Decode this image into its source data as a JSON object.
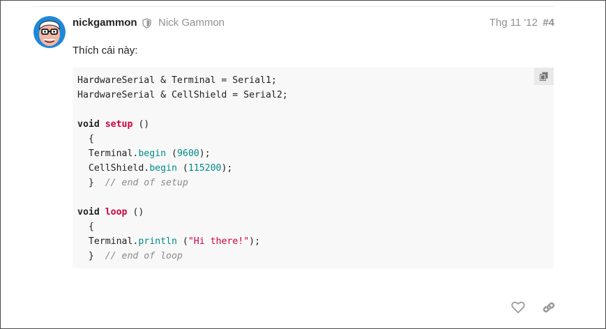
{
  "post": {
    "username": "nickgammon",
    "full_name": "Nick Gammon",
    "date": "Thg 11 '12",
    "post_number": "#4",
    "body_text": "Thích cái này:",
    "avatar_icon": "cartoon-avatar",
    "moderator_icon": "shield-icon"
  },
  "code": {
    "copy_icon": "copy-icon",
    "lines": [
      [
        {
          "t": "plain",
          "v": "HardwareSerial & Terminal = Serial1;"
        }
      ],
      [
        {
          "t": "plain",
          "v": "HardwareSerial & CellShield = Serial2;"
        }
      ],
      [],
      [
        {
          "t": "kw",
          "v": "void"
        },
        {
          "t": "plain",
          "v": " "
        },
        {
          "t": "fn",
          "v": "setup"
        },
        {
          "t": "plain",
          "v": " ()"
        }
      ],
      [
        {
          "t": "plain",
          "v": "  {"
        }
      ],
      [
        {
          "t": "plain",
          "v": "  Terminal."
        },
        {
          "t": "method",
          "v": "begin"
        },
        {
          "t": "plain",
          "v": " ("
        },
        {
          "t": "num",
          "v": "9600"
        },
        {
          "t": "plain",
          "v": ");"
        }
      ],
      [
        {
          "t": "plain",
          "v": "  CellShield."
        },
        {
          "t": "method",
          "v": "begin"
        },
        {
          "t": "plain",
          "v": " ("
        },
        {
          "t": "num",
          "v": "115200"
        },
        {
          "t": "plain",
          "v": ");"
        }
      ],
      [
        {
          "t": "plain",
          "v": "  }  "
        },
        {
          "t": "comment",
          "v": "// end of setup"
        }
      ],
      [],
      [
        {
          "t": "kw",
          "v": "void"
        },
        {
          "t": "plain",
          "v": " "
        },
        {
          "t": "fn",
          "v": "loop"
        },
        {
          "t": "plain",
          "v": " ()"
        }
      ],
      [
        {
          "t": "plain",
          "v": "  {"
        }
      ],
      [
        {
          "t": "plain",
          "v": "  Terminal."
        },
        {
          "t": "method",
          "v": "println"
        },
        {
          "t": "plain",
          "v": " ("
        },
        {
          "t": "str",
          "v": "\"Hi there!\""
        },
        {
          "t": "plain",
          "v": ");"
        }
      ],
      [
        {
          "t": "plain",
          "v": "  }  "
        },
        {
          "t": "comment",
          "v": "// end of loop"
        }
      ]
    ]
  },
  "actions": {
    "like_icon": "heart-icon",
    "share_icon": "link-icon"
  },
  "colors": {
    "keyword_fn": "#d0003c",
    "method_num": "#008b8b",
    "comment": "#8a8a8a",
    "muted": "#919191",
    "code_bg": "#f8f8f8"
  }
}
